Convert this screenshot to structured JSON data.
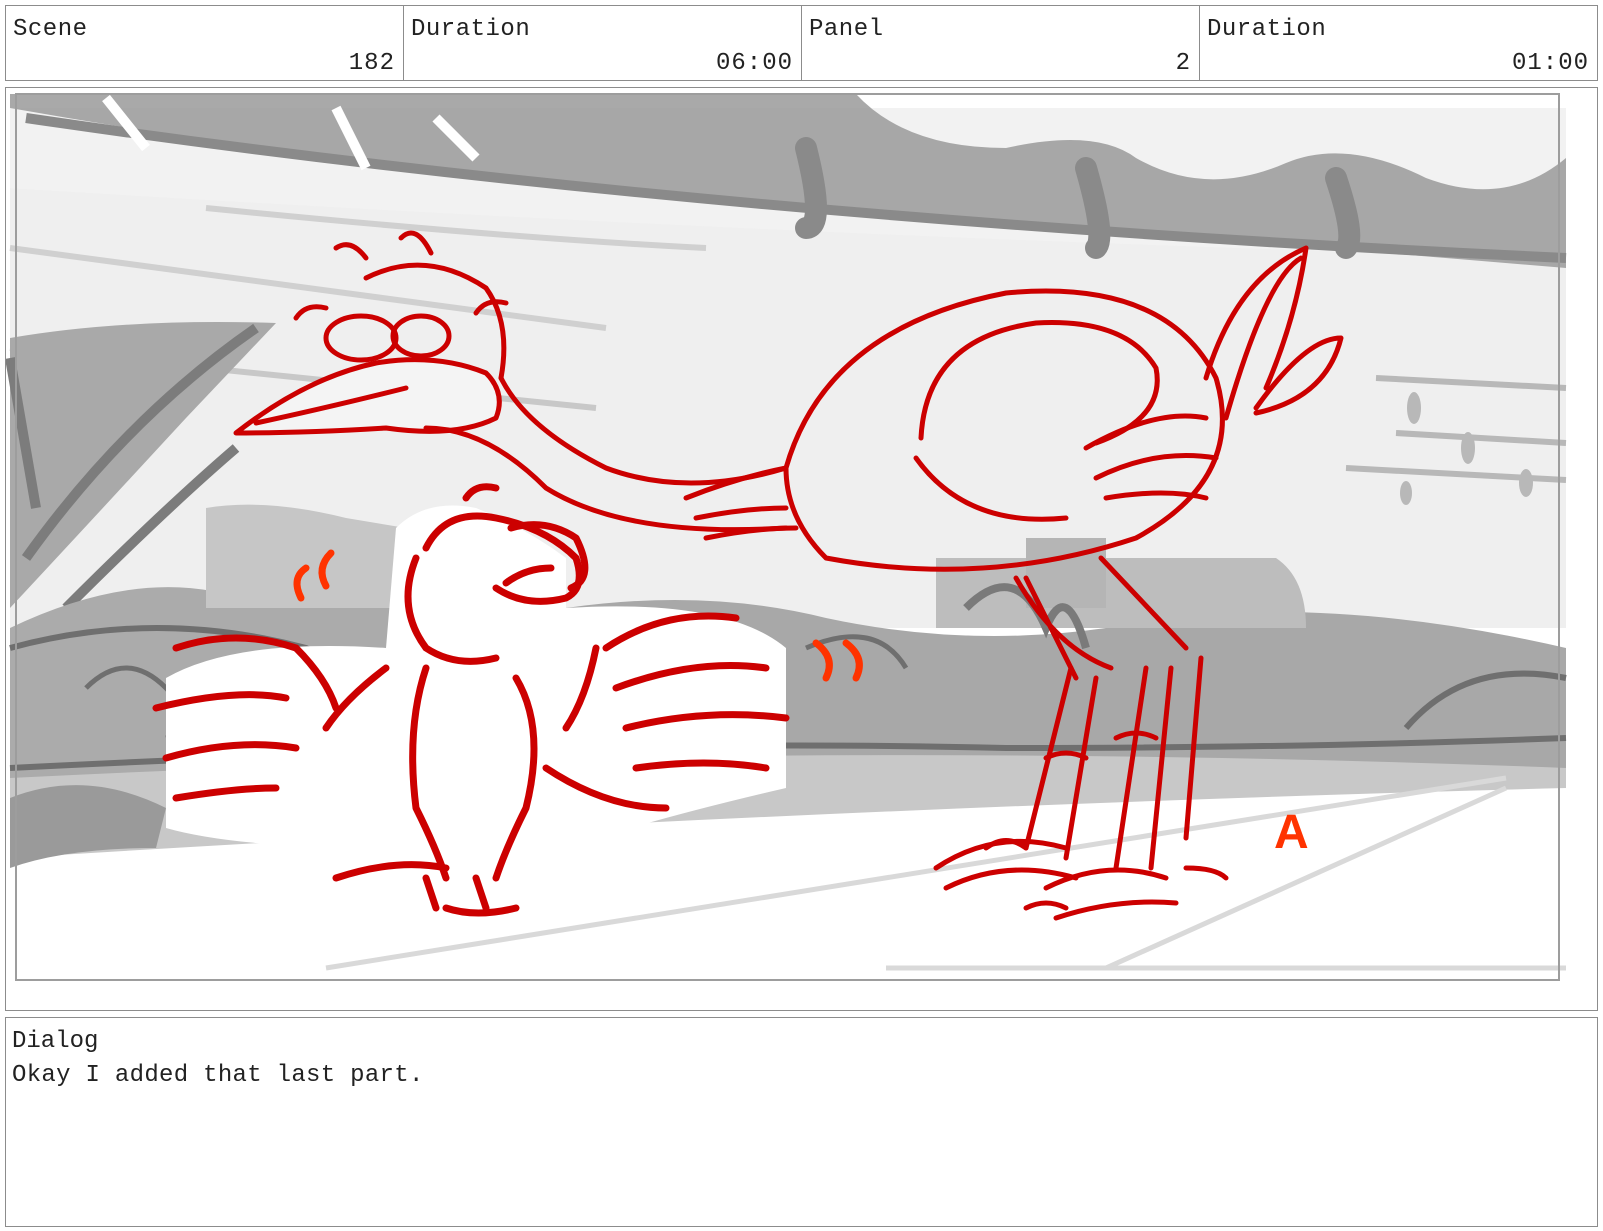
{
  "header": {
    "cells": [
      {
        "label": "Scene",
        "value": "182"
      },
      {
        "label": "Duration",
        "value": "06:00"
      },
      {
        "label": "Panel",
        "value": "2"
      },
      {
        "label": "Duration",
        "value": "01:00"
      }
    ]
  },
  "panel": {
    "annotation": "A",
    "colors": {
      "line": "#cc0000",
      "accent": "#ff3300",
      "background_gray": "#a8a8a8"
    }
  },
  "dialog": {
    "label": "Dialog",
    "text": "Okay I added that last part."
  }
}
